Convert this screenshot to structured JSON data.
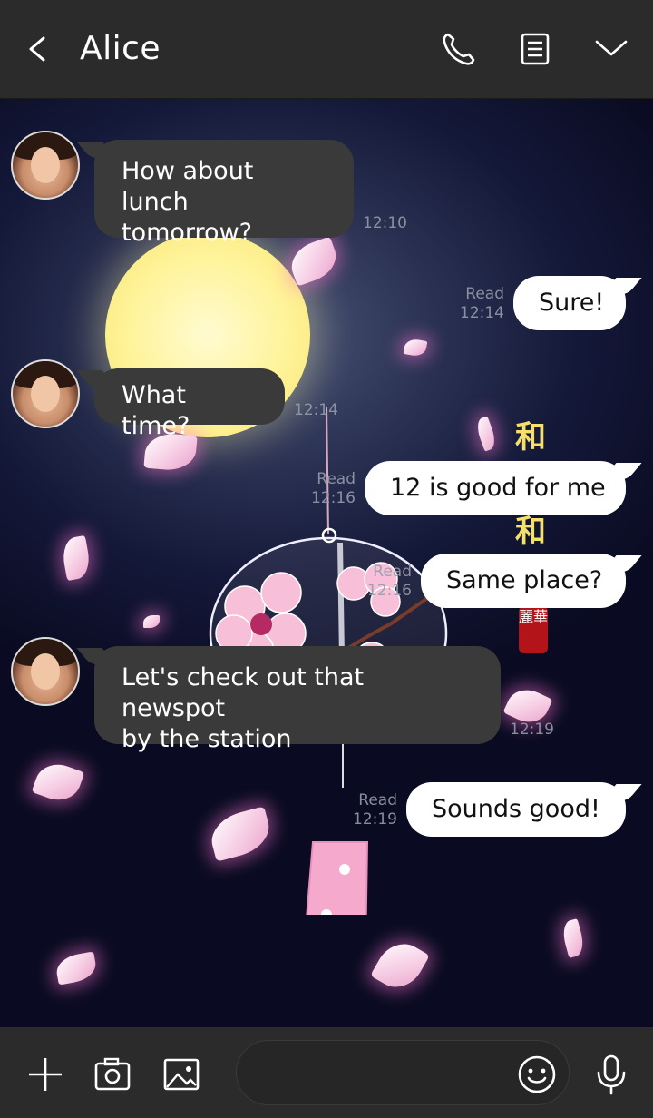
{
  "header": {
    "title": "Alice",
    "icons": [
      "back-arrow-icon",
      "phone-icon",
      "memo-icon",
      "chevron-down-icon"
    ]
  },
  "decor": {
    "kanji_top": "和",
    "kanji_mid": "和",
    "seal": "麗華"
  },
  "messages": [
    {
      "side": "in",
      "text_lines": [
        "How about lunch",
        "tomorrow?"
      ],
      "time": "12:10"
    },
    {
      "side": "out",
      "text": "Sure!",
      "read": "Read",
      "time": "12:14"
    },
    {
      "side": "in",
      "text_lines": [
        "What time?"
      ],
      "time": "12:14"
    },
    {
      "side": "out",
      "text": "12 is good for me",
      "read": "Read",
      "time": "12:16"
    },
    {
      "side": "out",
      "text": "Same place?",
      "read": "Read",
      "time": "12:16"
    },
    {
      "side": "in",
      "text_lines": [
        "Let's check out that newspot",
        "by the station"
      ],
      "time": "12:19"
    },
    {
      "side": "out",
      "text": "Sounds good!",
      "read": "Read",
      "time": "12:19"
    }
  ],
  "composer": {
    "placeholder": "",
    "icons": [
      "plus-icon",
      "camera-icon",
      "image-icon",
      "emoji-icon",
      "microphone-icon"
    ]
  },
  "colors": {
    "header_bg": "#2b2b2b",
    "incoming_bubble": "#3a3a3a",
    "outgoing_bubble": "#ffffff",
    "moon": "#fff39a",
    "petal": "#f6cde4"
  }
}
